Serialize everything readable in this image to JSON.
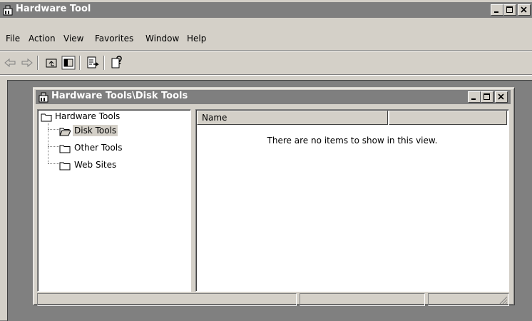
{
  "window": {
    "title": "Hardware Tool"
  },
  "menu": {
    "file": "File",
    "action": "Action",
    "view": "View",
    "favorites": "Favorites",
    "window": "Window",
    "help": "Help"
  },
  "toolbar": {
    "icons": [
      "back-icon",
      "forward-icon",
      "up-one-level-icon",
      "show-hide-tree-icon",
      "export-list-icon",
      "help-icon"
    ]
  },
  "child_window": {
    "title": "Hardware Tools\\Disk Tools"
  },
  "tree": {
    "root": "Hardware Tools",
    "items": [
      "Disk Tools",
      "Other Tools",
      "Web Sites"
    ],
    "selected": "Disk Tools"
  },
  "list": {
    "columns": [
      "Name",
      ""
    ],
    "empty_message": "There are no items to show in this view."
  },
  "colors": {
    "titlebar_inactive": "#7f7f7f",
    "face": "#d4d0c8",
    "mdi_background": "#808080"
  }
}
